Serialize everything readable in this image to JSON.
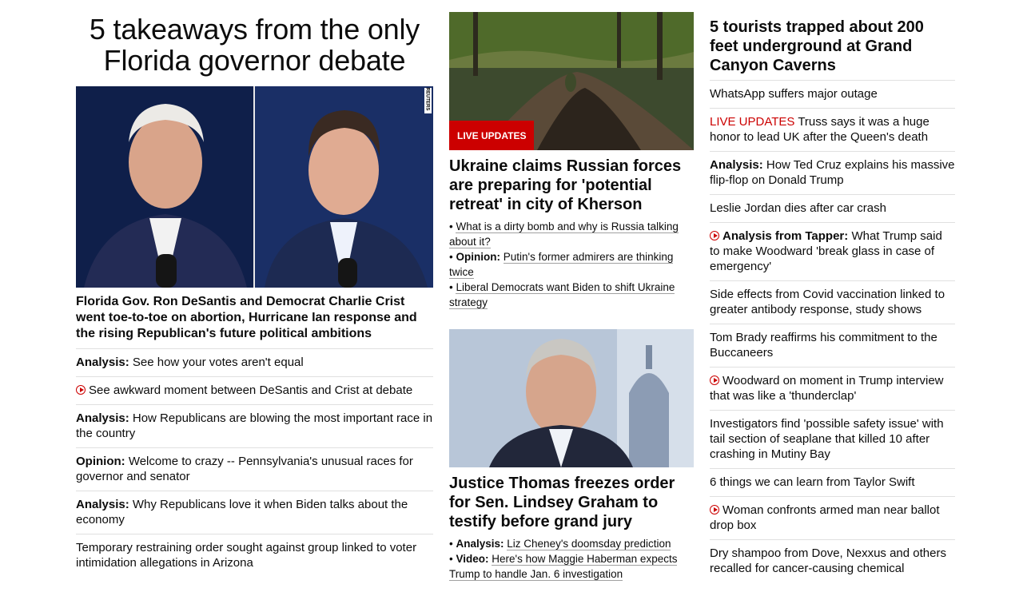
{
  "lead": {
    "title": "5 takeaways from the only Florida governor debate",
    "photo_credit": "REUTERS",
    "description": "Florida Gov. Ron DeSantis and Democrat Charlie Crist went toe-to-toe on abortion, Hurricane Ian response and the rising Republican's future political ambitions",
    "related": [
      {
        "label": "Analysis:",
        "text": "See how your votes aren't equal",
        "video": false
      },
      {
        "label": "",
        "text": "See awkward moment between DeSantis and Crist at debate",
        "video": true
      },
      {
        "label": "Analysis:",
        "text": "How Republicans are blowing the most important race in the country",
        "video": false
      },
      {
        "label": "Opinion:",
        "text": "Welcome to crazy -- Pennsylvania's unusual races for governor and senator",
        "video": false
      },
      {
        "label": "Analysis:",
        "text": "Why Republicans love it when Biden talks about the economy",
        "video": false
      },
      {
        "label": "",
        "text": "Temporary restraining order sought against group linked to voter intimidation allegations in Arizona",
        "video": false
      }
    ]
  },
  "story1": {
    "badge": "LIVE UPDATES",
    "title": "Ukraine claims Russian forces are preparing for 'potential retreat' in city of Kherson",
    "bullets": [
      {
        "label": "",
        "text": "What is a dirty bomb and why is Russia talking about it?"
      },
      {
        "label": "Opinion:",
        "text": "Putin's former admirers are thinking twice"
      },
      {
        "label": "",
        "text": "Liberal Democrats want Biden to shift Ukraine strategy"
      }
    ]
  },
  "story2": {
    "title": "Justice Thomas freezes order for Sen. Lindsey Graham to testify before grand jury",
    "bullets": [
      {
        "label": "Analysis:",
        "text": "Liz Cheney's doomsday prediction"
      },
      {
        "label": "Video:",
        "text": "Here's how Maggie Haberman expects Trump to handle Jan. 6 investigation"
      }
    ]
  },
  "sidebar": {
    "title": "5 tourists trapped about 200 feet underground at Grand Canyon Caverns",
    "items": [
      {
        "prefix": "",
        "label": "",
        "text": "WhatsApp suffers major outage",
        "video": false
      },
      {
        "prefix": "LIVE UPDATES",
        "label": "",
        "text": "Truss says it was a huge honor to lead UK after the Queen's death",
        "video": false
      },
      {
        "prefix": "",
        "label": "Analysis:",
        "text": "How Ted Cruz explains his massive flip-flop on Donald Trump",
        "video": false
      },
      {
        "prefix": "",
        "label": "",
        "text": "Leslie Jordan dies after car crash",
        "video": false
      },
      {
        "prefix": "",
        "label": "Analysis from Tapper:",
        "text": "What Trump said to make Woodward 'break glass in case of emergency'",
        "video": true
      },
      {
        "prefix": "",
        "label": "",
        "text": "Side effects from Covid vaccination linked to greater antibody response, study shows",
        "video": false
      },
      {
        "prefix": "",
        "label": "",
        "text": "Tom Brady reaffirms his commitment to the Buccaneers",
        "video": false
      },
      {
        "prefix": "",
        "label": "",
        "text": "Woodward on moment in Trump interview that was like a 'thunderclap'",
        "video": true
      },
      {
        "prefix": "",
        "label": "",
        "text": "Investigators find 'possible safety issue' with tail section of seaplane that killed 10 after crashing in Mutiny Bay",
        "video": false
      },
      {
        "prefix": "",
        "label": "",
        "text": "6 things we can learn from Taylor Swift",
        "video": false
      },
      {
        "prefix": "",
        "label": "",
        "text": "Woman confronts armed man near ballot drop box",
        "video": true
      },
      {
        "prefix": "",
        "label": "",
        "text": "Dry shampoo from Dove, Nexxus and others recalled for cancer-causing chemical",
        "video": false
      }
    ]
  },
  "colors": {
    "accent_red": "#cc0000",
    "divider": "#e0e0e0",
    "text": "#0c0c0c"
  }
}
